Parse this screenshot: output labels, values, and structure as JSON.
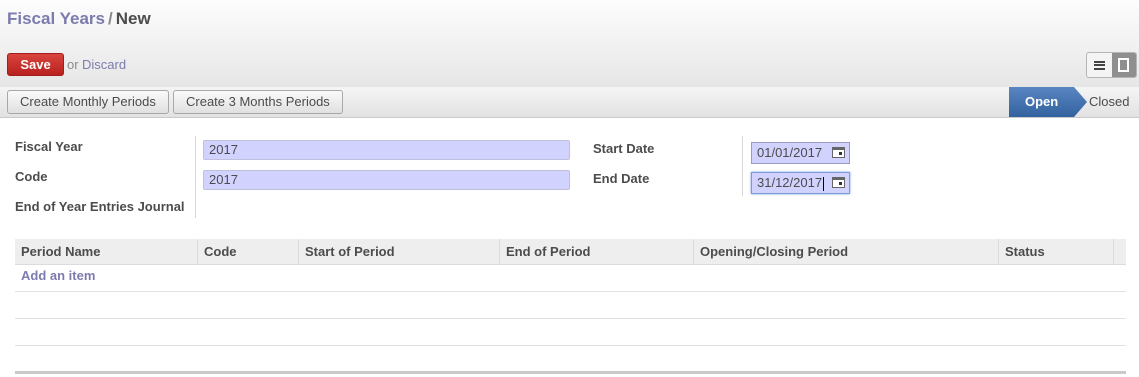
{
  "breadcrumb": {
    "parent": "Fiscal Years",
    "separator": "/",
    "current": "New"
  },
  "toolbar": {
    "save_label": "Save",
    "or_text": "or",
    "discard_label": "Discard"
  },
  "actions": {
    "monthly": "Create Monthly Periods",
    "quarterly": "Create 3 Months Periods"
  },
  "stages": {
    "active": "Open",
    "inactive": "Closed"
  },
  "form": {
    "fiscal_year_label": "Fiscal Year",
    "fiscal_year_value": "2017",
    "code_label": "Code",
    "code_value": "2017",
    "journal_label": "End of Year Entries Journal",
    "start_date_label": "Start Date",
    "start_date_value": "01/01/2017",
    "end_date_label": "End Date",
    "end_date_value": "31/12/2017"
  },
  "table": {
    "headers": [
      "Period Name",
      "Code",
      "Start of Period",
      "End of Period",
      "Opening/Closing Period",
      "Status"
    ],
    "add_item": "Add an item"
  },
  "colors": {
    "accent": "#7c7bad",
    "save": "#c4302b",
    "stage_active": "#3d6fad",
    "field_required": "#d2d2ff"
  },
  "icons": [
    "list-view-icon",
    "form-view-icon",
    "calendar-icon"
  ]
}
